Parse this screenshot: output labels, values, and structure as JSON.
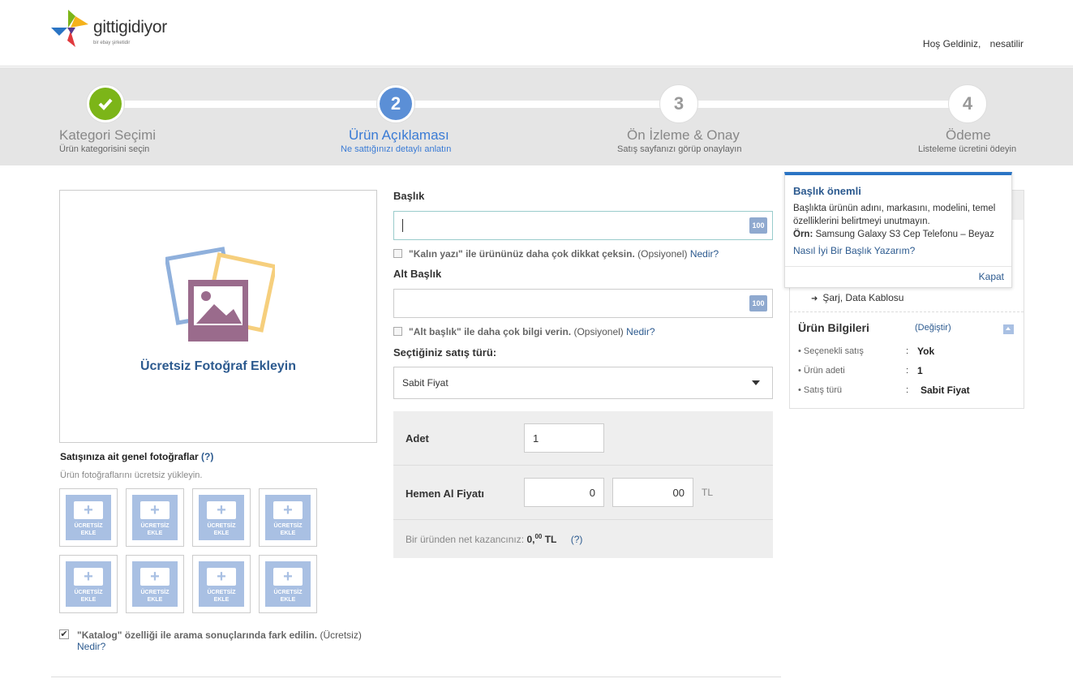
{
  "header": {
    "logo_text": "gittigidiyor",
    "logo_sub": "bir ebay şirketidir",
    "welcome": "Hoş Geldiniz,",
    "username": "nesatilir"
  },
  "steps": [
    {
      "number": "✓",
      "title": "Kategori Seçimi",
      "subtitle": "Ürün kategorisini seçin",
      "state": "done"
    },
    {
      "number": "2",
      "title": "Ürün Açıklaması",
      "subtitle": "Ne sattığınızı detaylı anlatın",
      "state": "active"
    },
    {
      "number": "3",
      "title": "Ön İzleme & Onay",
      "subtitle": "Satış sayfanızı görüp onaylayın",
      "state": "pending"
    },
    {
      "number": "4",
      "title": "Ödeme",
      "subtitle": "Listeleme ücretini ödeyin",
      "state": "pending"
    }
  ],
  "photos": {
    "main_label": "Ücretsiz Fotoğraf Ekleyin",
    "general_title": "Satışınıza ait genel fotoğraflar",
    "general_help": "(?)",
    "general_sub": "Ürün fotoğraflarını ücretsiz yükleyin.",
    "thumb_label_1": "ÜCRETSİZ",
    "thumb_label_2": "EKLE"
  },
  "catalog": {
    "bold": "\"Katalog\" özelliği ile arama sonuçlarında fark edilin.",
    "note": "(Ücretsiz)",
    "link": "Nedir?"
  },
  "form": {
    "title_label": "Başlık",
    "title_value": "",
    "title_counter": "100",
    "bold_option": "\"Kalın yazı\" ile ürününüz daha çok dikkat çeksin.",
    "bold_option_note": "(Opsiyonel)",
    "bold_option_link": "Nedir?",
    "subtitle_label": "Alt Başlık",
    "subtitle_value": "",
    "subtitle_counter": "100",
    "subtitle_option": "\"Alt başlık\" ile daha çok bilgi verin.",
    "subtitle_option_note": "(Opsiyonel)",
    "subtitle_option_link": "Nedir?",
    "sale_type_label": "Seçtiğiniz satış türü:",
    "sale_type_value": "Sabit Fiyat"
  },
  "price": {
    "qty_label": "Adet",
    "qty_value": "1",
    "buy_now_label": "Hemen Al Fiyatı",
    "price_int": "0",
    "price_dec": "00",
    "currency": "TL",
    "net_text": "Bir üründen net kazancınız:",
    "net_int": "0,",
    "net_dec": "00",
    "net_currency": "TL",
    "net_help": "(?)"
  },
  "sidebar": {
    "accessory_item": "Şarj, Data Kablosu",
    "info_title": "Ürün Bilgileri",
    "info_change": "(Değiştir)",
    "rows": [
      {
        "label": "Seçenekli satış",
        "value": "Yok"
      },
      {
        "label": "Ürün adeti",
        "value": "1"
      },
      {
        "label": "Satış türü",
        "value": "Sabit Fiyat"
      }
    ]
  },
  "tooltip": {
    "title": "Başlık önemli",
    "body": "Başlıkta ürünün adını, markasını, modelini, temel özelliklerini belirtmeyi unutmayın.",
    "example_label": "Örn:",
    "example": "Samsung Galaxy S3 Cep Telefonu – Beyaz",
    "link": "Nasıl İyi Bir Başlık Yazarım?",
    "close": "Kapat"
  }
}
